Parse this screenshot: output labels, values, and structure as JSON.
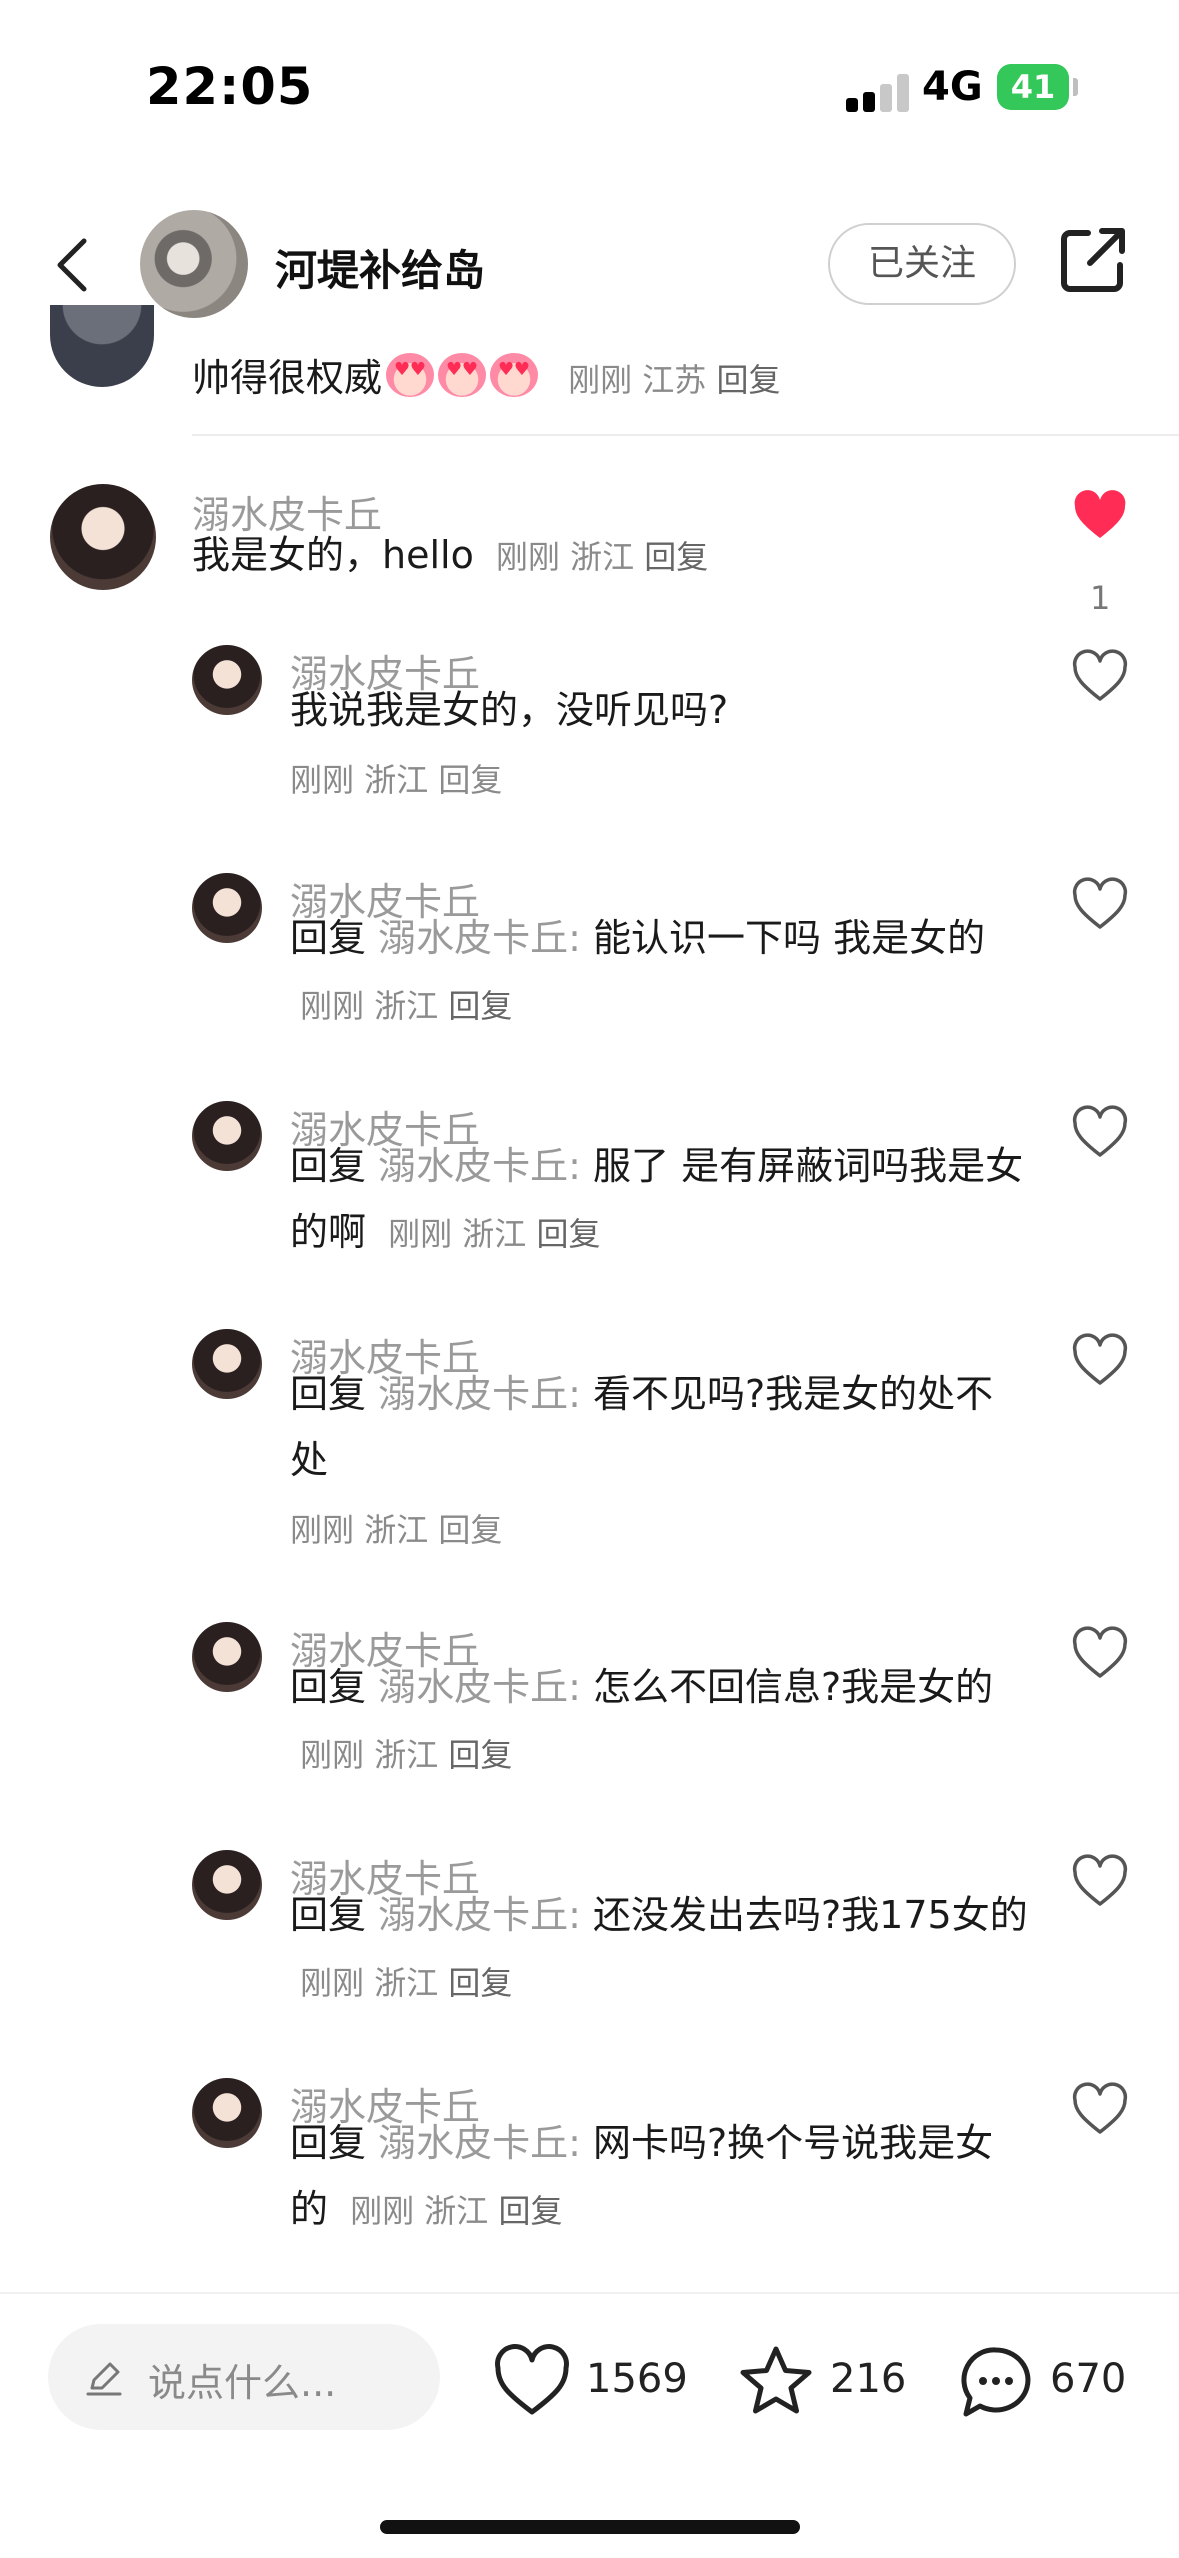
{
  "status_bar": {
    "time": "22:05",
    "network": "4G",
    "battery": "41"
  },
  "header": {
    "title": "河堤补给岛",
    "follow_label": "已关注"
  },
  "prev_comment": {
    "text": "帅得很权威",
    "time": "刚刚",
    "location": "江苏",
    "reply": "回复"
  },
  "main_comment": {
    "username": "溺水皮卡丘",
    "text": "我是女的，hello",
    "time": "刚刚",
    "location": "浙江",
    "reply": "回复",
    "like_count": "1"
  },
  "replies": [
    {
      "username": "溺水皮卡丘",
      "prefix": "",
      "at": "",
      "text": "我说我是女的，没听见吗?",
      "time": "刚刚",
      "location": "浙江",
      "reply": "回复"
    },
    {
      "username": "溺水皮卡丘",
      "prefix": "回复",
      "at": "溺水皮卡丘:",
      "text": "能认识一下吗 我是女的",
      "time": "刚刚",
      "location": "浙江",
      "reply": "回复"
    },
    {
      "username": "溺水皮卡丘",
      "prefix": "回复",
      "at": "溺水皮卡丘:",
      "text": "服了 是有屏蔽词吗我是女的啊",
      "time": "刚刚",
      "location": "浙江",
      "reply": "回复"
    },
    {
      "username": "溺水皮卡丘",
      "prefix": "回复",
      "at": "溺水皮卡丘:",
      "text": "看不见吗?我是女的处不处",
      "time": "刚刚",
      "location": "浙江",
      "reply": "回复"
    },
    {
      "username": "溺水皮卡丘",
      "prefix": "回复",
      "at": "溺水皮卡丘:",
      "text": "怎么不回信息?我是女的",
      "time": "刚刚",
      "location": "浙江",
      "reply": "回复"
    },
    {
      "username": "溺水皮卡丘",
      "prefix": "回复",
      "at": "溺水皮卡丘:",
      "text": "还没发出去吗?我175女的",
      "time": "刚刚",
      "location": "浙江",
      "reply": "回复"
    },
    {
      "username": "溺水皮卡丘",
      "prefix": "回复",
      "at": "溺水皮卡丘:",
      "text": "网卡吗?换个号说我是女的",
      "time": "刚刚",
      "location": "浙江",
      "reply": "回复"
    }
  ],
  "bottom_bar": {
    "input_placeholder": "说点什么...",
    "like_count": "1569",
    "star_count": "216",
    "comment_count": "670"
  },
  "colors": {
    "liked": "#ff2d55",
    "meta_gray": "#8a8a8a",
    "battery_green": "#34c759"
  }
}
